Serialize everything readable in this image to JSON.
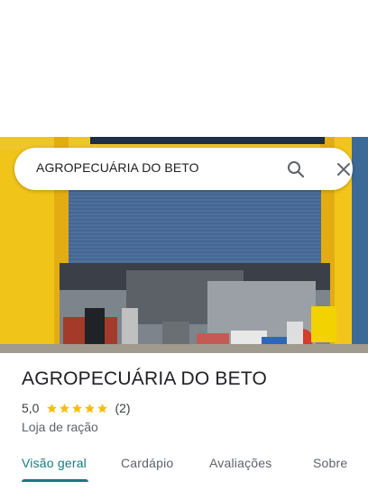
{
  "search": {
    "query": "AGROPECUÁRIA DO BETO",
    "search_icon": "search-icon",
    "close_icon": "close-icon"
  },
  "place": {
    "name": "AGROPECUÁRIA DO BETO",
    "rating": "5,0",
    "stars": 5,
    "review_count": "(2)",
    "category": "Loja de ração"
  },
  "tabs": [
    {
      "label": "Visão geral",
      "active": true
    },
    {
      "label": "Cardápio",
      "active": false
    },
    {
      "label": "Avaliações",
      "active": false
    },
    {
      "label": "Sobre",
      "active": false
    }
  ],
  "colors": {
    "accent": "#137a7f",
    "star": "#fbbc04",
    "storefront_yellow": "#f2c21a",
    "shutter_blue": "#4a6d99"
  }
}
